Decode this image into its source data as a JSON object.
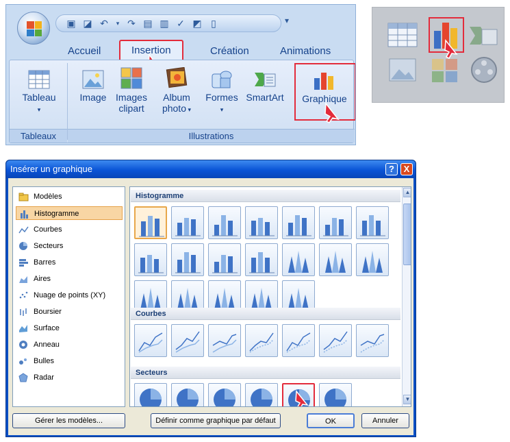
{
  "ribbon": {
    "tabs": [
      "Accueil",
      "Insertion",
      "Création",
      "Animations"
    ],
    "active_tab": "Insertion",
    "buttons": {
      "tableau": "Tableau",
      "image": "Image",
      "images_clipart_1": "Images",
      "images_clipart_2": "clipart",
      "album_1": "Album",
      "album_2": "photo",
      "formes": "Formes",
      "smartart": "SmartArt",
      "graphique": "Graphique"
    },
    "groups": {
      "tableaux": "Tableaux",
      "illustrations": "Illustrations"
    }
  },
  "dialog": {
    "title": "Insérer un graphique",
    "categories": [
      {
        "label": "Modèles",
        "icon": "folder-icon"
      },
      {
        "label": "Histogramme",
        "icon": "column-chart-icon"
      },
      {
        "label": "Courbes",
        "icon": "line-chart-icon"
      },
      {
        "label": "Secteurs",
        "icon": "pie-chart-icon"
      },
      {
        "label": "Barres",
        "icon": "bar-chart-icon"
      },
      {
        "label": "Aires",
        "icon": "area-chart-icon"
      },
      {
        "label": "Nuage de points (XY)",
        "icon": "scatter-chart-icon"
      },
      {
        "label": "Boursier",
        "icon": "stock-chart-icon"
      },
      {
        "label": "Surface",
        "icon": "surface-chart-icon"
      },
      {
        "label": "Anneau",
        "icon": "doughnut-chart-icon"
      },
      {
        "label": "Bulles",
        "icon": "bubble-chart-icon"
      },
      {
        "label": "Radar",
        "icon": "radar-chart-icon"
      }
    ],
    "selected_category": "Histogramme",
    "sections": {
      "histogramme": "Histogramme",
      "courbes": "Courbes",
      "secteurs": "Secteurs"
    },
    "buttons": {
      "manage": "Gérer les modèles...",
      "default": "Définir comme graphique par défaut",
      "ok": "OK",
      "cancel": "Annuler"
    },
    "title_buttons": {
      "help": "?",
      "close": "X"
    }
  },
  "colors": {
    "highlight_red": "#e32b3b",
    "ribbon_text": "#15428b",
    "title_bar": "#0a54d6",
    "selection": "#f8d6a4"
  }
}
